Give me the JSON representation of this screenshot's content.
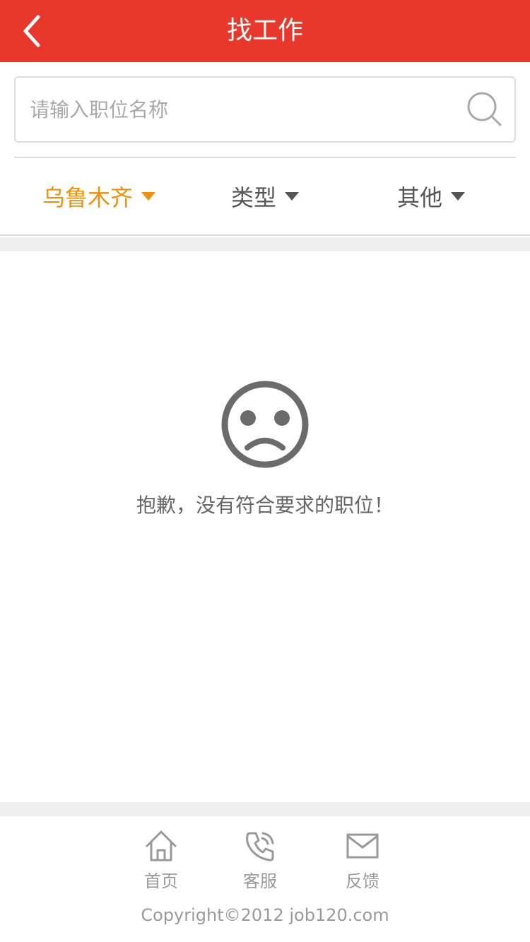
{
  "header": {
    "title": "找工作",
    "back_icon": "chevron-left-icon"
  },
  "search": {
    "placeholder": "请输入职位名称",
    "value": "",
    "icon": "search-icon"
  },
  "filters": [
    {
      "label": "乌鲁木齐",
      "active": true
    },
    {
      "label": "类型",
      "active": false
    },
    {
      "label": "其他",
      "active": false
    }
  ],
  "empty_state": {
    "icon": "sad-face-icon",
    "message": "抱歉，没有符合要求的职位！"
  },
  "footer": {
    "nav": [
      {
        "label": "首页",
        "icon": "home-icon"
      },
      {
        "label": "客服",
        "icon": "phone-icon"
      },
      {
        "label": "反馈",
        "icon": "mail-icon"
      }
    ],
    "copyright": "Copyright©2012  job120.com"
  },
  "colors": {
    "header_bg": "#e8382b",
    "active_filter": "#f0900a",
    "text_gray": "#666666"
  }
}
